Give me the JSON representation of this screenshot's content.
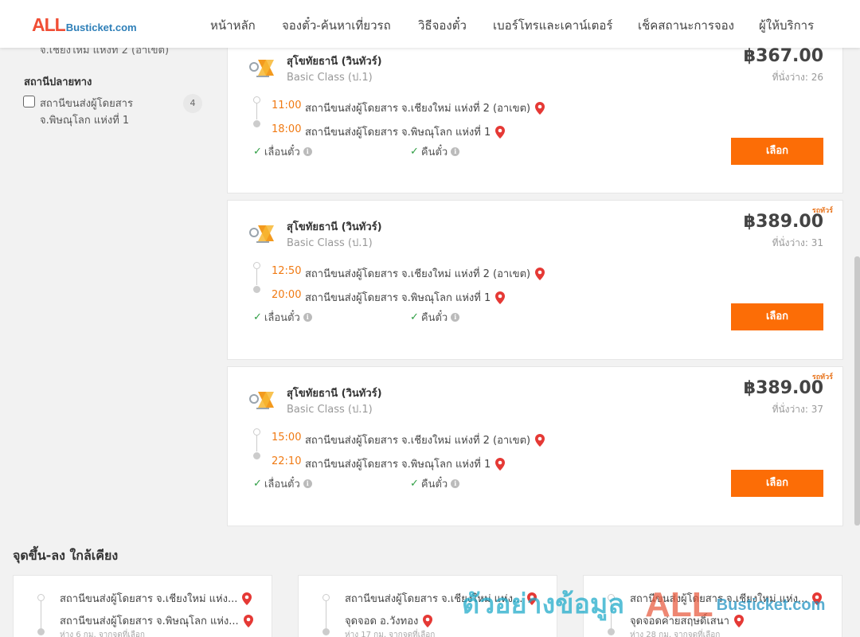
{
  "header": {
    "logo_all": "ALL",
    "logo_sub": "Busticket.com",
    "nav": [
      {
        "label": "หน้าหลัก"
      },
      {
        "label": "จองตั๋ว-ค้นหาเที่ยวรถ"
      },
      {
        "label": "วิธีจองตั๋ว"
      },
      {
        "label": "เบอร์โทรและเคาน์เตอร์"
      },
      {
        "label": "เช็คสถานะการจอง"
      },
      {
        "label": "ผู้ให้บริการ"
      }
    ]
  },
  "sidebar": {
    "cut_text": "จ.เชียงใหม่ แห่งที่ 2 (อาเขต)",
    "destination_title": "สถานีปลายทาง",
    "destination_option": {
      "label": "สถานีขนส่งผู้โดยสาร จ.พิษณุโลก แห่งที่ 1",
      "count": "4"
    }
  },
  "trips": [
    {
      "operator": "สุโขทัยธานี (วินทัวร์)",
      "class": "Basic Class (ป.1)",
      "price": "฿367.00",
      "seats": "ที่นั่งว่าง: 26",
      "promo": "",
      "depart_time": "11:00",
      "depart_stop": "สถานีขนส่งผู้โดยสาร จ.เชียงใหม่ แห่งที่ 2 (อาเขต)",
      "arrive_time": "18:00",
      "arrive_stop": "สถานีขนส่งผู้โดยสาร จ.พิษณุโลก แห่งที่ 1",
      "feature_1": "เลื่อนตั๋ว",
      "feature_2": "คืนตั๋ว",
      "select_label": "เลือก"
    },
    {
      "operator": "สุโขทัยธานี (วินทัวร์)",
      "class": "Basic Class (ป.1)",
      "price": "฿389.00",
      "seats": "ที่นั่งว่าง: 31",
      "promo": "รถทัวร์",
      "depart_time": "12:50",
      "depart_stop": "สถานีขนส่งผู้โดยสาร จ.เชียงใหม่ แห่งที่ 2 (อาเขต)",
      "arrive_time": "20:00",
      "arrive_stop": "สถานีขนส่งผู้โดยสาร จ.พิษณุโลก แห่งที่ 1",
      "feature_1": "เลื่อนตั๋ว",
      "feature_2": "คืนตั๋ว",
      "select_label": "เลือก"
    },
    {
      "operator": "สุโขทัยธานี (วินทัวร์)",
      "class": "Basic Class (ป.1)",
      "price": "฿389.00",
      "seats": "ที่นั่งว่าง: 37",
      "promo": "รถทัวร์",
      "depart_time": "15:00",
      "depart_stop": "สถานีขนส่งผู้โดยสาร จ.เชียงใหม่ แห่งที่ 2 (อาเขต)",
      "arrive_time": "22:10",
      "arrive_stop": "สถานีขนส่งผู้โดยสาร จ.พิษณุโลก แห่งที่ 1",
      "feature_1": "เลื่อนตั๋ว",
      "feature_2": "คืนตั๋ว",
      "select_label": "เลือก"
    }
  ],
  "nearby": {
    "title": "จุดขึ้น-ลง ใกล้เคียง",
    "cards": [
      {
        "from": "สถานีขนส่งผู้โดยสาร จ.เชียงใหม่ แห่ง...",
        "to": "สถานีขนส่งผู้โดยสาร จ.พิษณุโลก แห่ง...",
        "distance": "ห่าง 6 กม. จากจุดที่เลือก"
      },
      {
        "from": "สถานีขนส่งผู้โดยสาร จ.เชียงใหม่ แห่ง...",
        "to": "จุดจอด อ.วังทอง",
        "distance": "ห่าง 17 กม. จากจุดที่เลือก"
      },
      {
        "from": "สถานีขนส่งผู้โดยสาร จ.เชียงใหม่ แห่ง...",
        "to": "จุดจอดค่ายสฤษดิ์เสนา",
        "distance": "ห่าง 28 กม. จากจุดที่เลือก"
      }
    ]
  },
  "watermark": {
    "text": "ตัวอย่างข้อมูล",
    "all": "ALL",
    "sub": "Busticket.com"
  },
  "colors": {
    "accent": "#fc6d06",
    "time": "#f07a13",
    "pin": "#e53935",
    "check": "#2f9e44"
  },
  "icons": {
    "pin": "map-pin-icon",
    "check": "check-icon",
    "info": "info-icon",
    "operator": "operator-logo-icon"
  }
}
